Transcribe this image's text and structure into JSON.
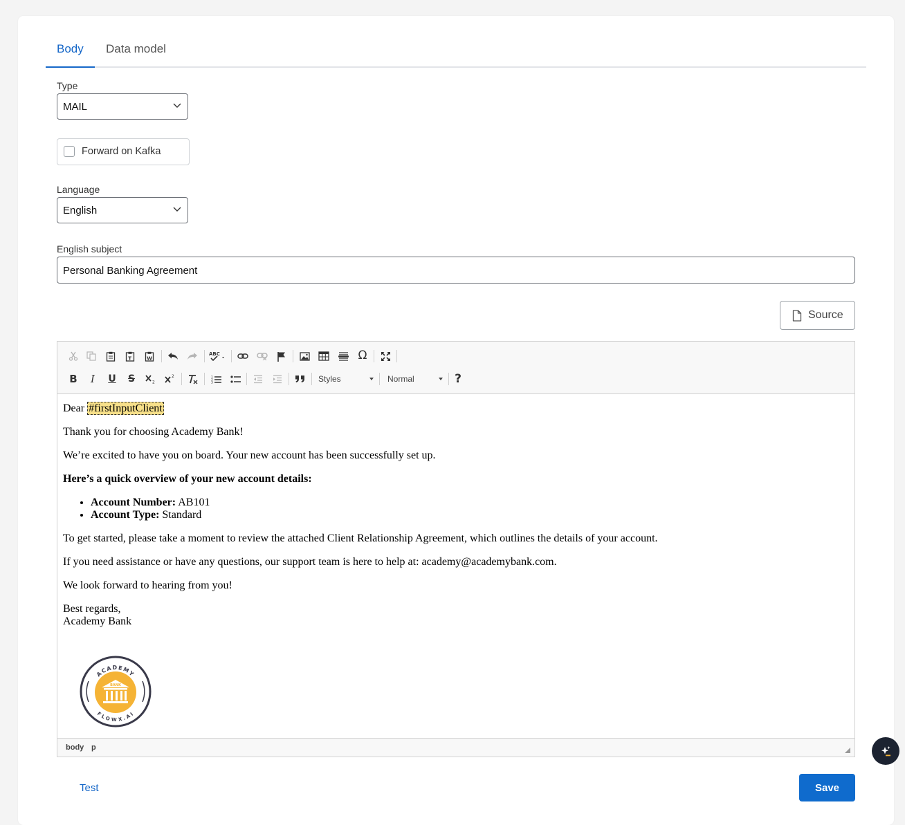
{
  "tabs": [
    {
      "label": "Body",
      "active": true
    },
    {
      "label": "Data model",
      "active": false
    }
  ],
  "type_field": {
    "label": "Type",
    "value": "MAIL"
  },
  "kafka": {
    "label": "Forward on Kafka",
    "checked": false
  },
  "language_field": {
    "label": "Language",
    "value": "English"
  },
  "subject_field": {
    "label": "English subject",
    "value": "Personal Banking Agreement"
  },
  "source_button": {
    "label": "Source"
  },
  "toolbar": {
    "styles_combo": "Styles",
    "format_combo": "Normal",
    "help": "?",
    "omega": "Ω"
  },
  "body": {
    "greeting": "Dear ",
    "placeholder": "#firstInputClient",
    "p1": "Thank you for choosing Academy Bank!",
    "p2": "We’re excited to have you on board. Your new account has been successfully set up.",
    "overview": "Here’s a quick overview of your new account details:",
    "details": [
      {
        "key": "Account Number:",
        "value": " AB101"
      },
      {
        "key": "Account Type:",
        "value": " Standard"
      }
    ],
    "p3": "To get started, please take a moment to review the attached Client Relationship Agreement, which outlines the details of your account.",
    "p4": "If you need assistance or have any questions, our support team is here to help at: academy@academybank.com.",
    "p5": "We look forward to hearing from you!",
    "signoff": "Best regards,",
    "signature": "Academy Bank"
  },
  "logo": {
    "top_text": "ACADEMY",
    "bottom_text": "FLOWX.AI",
    "badge_text": "BANK",
    "color_ring": "#3a3a4a",
    "color_fill": "#f5b335"
  },
  "statusbar": {
    "crumb1": "body",
    "crumb2": "p"
  },
  "actions": {
    "test": "Test",
    "save": "Save"
  },
  "colors": {
    "primary": "#1567c8",
    "placeholder_bg": "#f7e08a"
  }
}
